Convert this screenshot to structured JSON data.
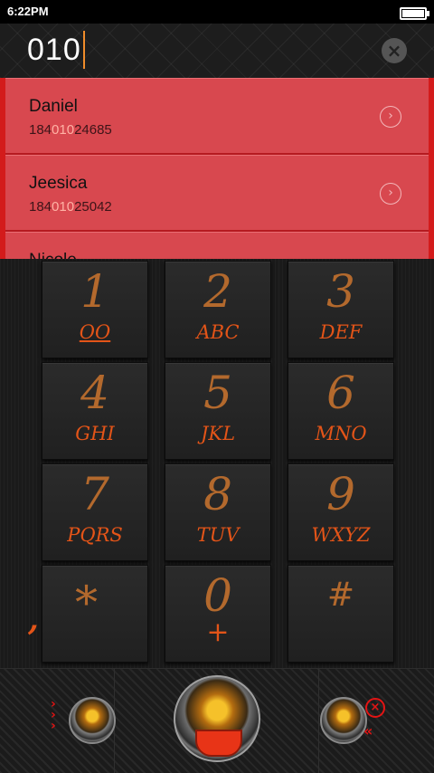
{
  "status_bar": {
    "time": "6:22PM"
  },
  "dial_input": {
    "value": "010"
  },
  "results": [
    {
      "name": "Daniel",
      "number_prefix": "184",
      "number_match": "010",
      "number_suffix": "24685"
    },
    {
      "name": "Jeesica",
      "number_prefix": "184",
      "number_match": "010",
      "number_suffix": "25042"
    },
    {
      "name": "Nicole",
      "number_prefix": "",
      "number_match": "",
      "number_suffix": ""
    }
  ],
  "keypad": [
    {
      "digit": "1",
      "letters": "OO"
    },
    {
      "digit": "2",
      "letters": "ABC"
    },
    {
      "digit": "3",
      "letters": "DEF"
    },
    {
      "digit": "4",
      "letters": "GHI"
    },
    {
      "digit": "5",
      "letters": "JKL"
    },
    {
      "digit": "6",
      "letters": "MNO"
    },
    {
      "digit": "7",
      "letters": "PQRS"
    },
    {
      "digit": "8",
      "letters": "TUV"
    },
    {
      "digit": "9",
      "letters": "WXYZ"
    },
    {
      "digit": "*",
      "letters": ","
    },
    {
      "digit": "0",
      "letters": "+"
    },
    {
      "digit": "#",
      "letters": ""
    }
  ],
  "colors": {
    "accent": "#e35418",
    "result_card": "#d8484f",
    "match_highlight": "#ffb2a5"
  },
  "icons": [
    "battery-icon",
    "clear-icon",
    "chevron-right-icon",
    "dragon-logo-icon",
    "dial-call-icon",
    "red-chevrons-icon",
    "red-x-icon",
    "red-back-icon"
  ]
}
